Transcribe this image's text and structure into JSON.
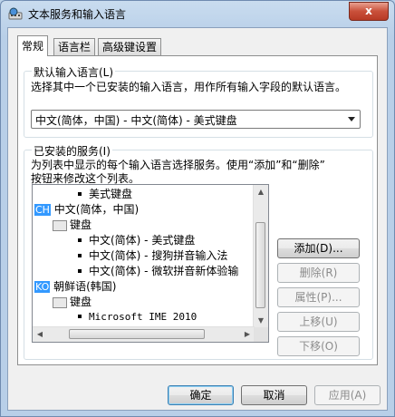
{
  "window": {
    "title": "文本服务和输入语言",
    "close_label": "x"
  },
  "tabs": [
    {
      "label": "常规",
      "active": true
    },
    {
      "label": "语言栏",
      "active": false
    },
    {
      "label": "高级键设置",
      "active": false
    }
  ],
  "default_language": {
    "group_title": "默认输入语言(L)",
    "description": "选择其中一个已安装的输入语言，用作所有输入字段的默认语言。",
    "selected_value": "中文(简体，中国) - 中文(简体) - 美式键盘"
  },
  "installed_services": {
    "group_title": "已安装的服务(I)",
    "description_line1": "为列表中显示的每个输入语言选择服务。使用“添加”和“删除”",
    "description_line2": "按钮来修改这个列表。",
    "tree": {
      "item_us_keyboard_top": "美式键盘",
      "ch_badge": "CH",
      "ch_language": "中文(简体，中国)",
      "ch_keyboard_group": "键盘",
      "ch_item1": "中文(简体) - 美式键盘",
      "ch_item2": "中文(简体) - 搜狗拼音输入法",
      "ch_item3": "中文(简体) - 微软拼音新体验输",
      "ko_badge": "KO",
      "ko_language": "朝鲜语(韩国)",
      "ko_keyboard_group": "键盘",
      "ko_item1": "Microsoft IME 2010"
    }
  },
  "side_buttons": {
    "add": "添加(D)...",
    "remove": "删除(R)",
    "properties": "属性(P)...",
    "move_up": "上移(U)",
    "move_down": "下移(O)"
  },
  "footer_buttons": {
    "ok": "确定",
    "cancel": "取消",
    "apply": "应用(A)"
  }
}
